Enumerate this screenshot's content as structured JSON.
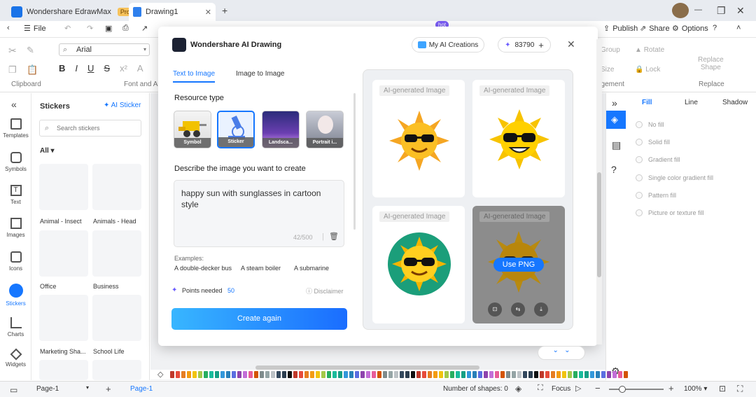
{
  "tabs": [
    {
      "label": "Wondershare EdrawMax",
      "badge": "Pro"
    },
    {
      "label": "Drawing1"
    }
  ],
  "menubar": {
    "file": "File",
    "publish": "Publish",
    "share": "Share",
    "options": "Options",
    "hot_badge": "hot"
  },
  "ribbon": {
    "font_name": "Arial",
    "clipboard": "Clipboard",
    "font_and_alignment": "Font and Al",
    "group": "Group",
    "rotate": "Rotate",
    "size": "Size",
    "lock": "Lock",
    "replace_shape_1": "Replace",
    "replace_shape_2": "Shape",
    "arrangement": "agement",
    "replace": "Replace"
  },
  "rail": [
    {
      "label": "Templates",
      "icon": "template-icon"
    },
    {
      "label": "Symbols",
      "icon": "symbols-icon"
    },
    {
      "label": "Text",
      "icon": "text-icon"
    },
    {
      "label": "Images",
      "icon": "images-icon"
    },
    {
      "label": "Icons",
      "icon": "icons-icon"
    },
    {
      "label": "Stickers",
      "icon": "stickers-icon"
    },
    {
      "label": "Charts",
      "icon": "charts-icon"
    },
    {
      "label": "Widgets",
      "icon": "widgets-icon"
    }
  ],
  "stickers": {
    "title": "Stickers",
    "ai_sticker": "AI Sticker",
    "search_placeholder": "Search stickers",
    "filter": "All",
    "categories": [
      "Animal - Insect",
      "Animals - Head",
      "Office",
      "Business",
      "Marketing Sha...",
      "School Life"
    ]
  },
  "modal": {
    "title": "Wondershare AI Drawing",
    "my_creations": "My AI Creations",
    "points": "83790",
    "tab_text": "Text to Image",
    "tab_image": "Image to Image",
    "resource_type": "Resource type",
    "types": [
      "Symbol",
      "Sticker",
      "Landsca...",
      "Portrait i..."
    ],
    "describe_label": "Describe the image you want to create",
    "prompt": "happy sun with sunglasses in cartoon style",
    "char_count": "42/500",
    "examples_label": "Examples:",
    "examples": [
      "A double-decker bus",
      "A steam boiler",
      "A submarine"
    ],
    "points_needed_label": "Points needed",
    "points_needed": "50",
    "disclaimer": "Disclaimer",
    "create_again": "Create again",
    "ai_tag": "AI-generated Image",
    "use_png": "Use PNG"
  },
  "right_panel": {
    "tabs": [
      "Fill",
      "Line",
      "Shadow"
    ],
    "fill_options": [
      "No fill",
      "Solid fill",
      "Gradient fill",
      "Single color gradient fill",
      "Pattern fill",
      "Picture or texture fill"
    ]
  },
  "status": {
    "page_select": "Page-1",
    "page_tab": "Page-1",
    "shapes": "Number of shapes: 0",
    "focus": "Focus",
    "zoom": "100%"
  },
  "colors": {
    "accent": "#1677ff",
    "create_gradient_start": "#36b0ff",
    "create_gradient_end": "#1a6dff"
  }
}
